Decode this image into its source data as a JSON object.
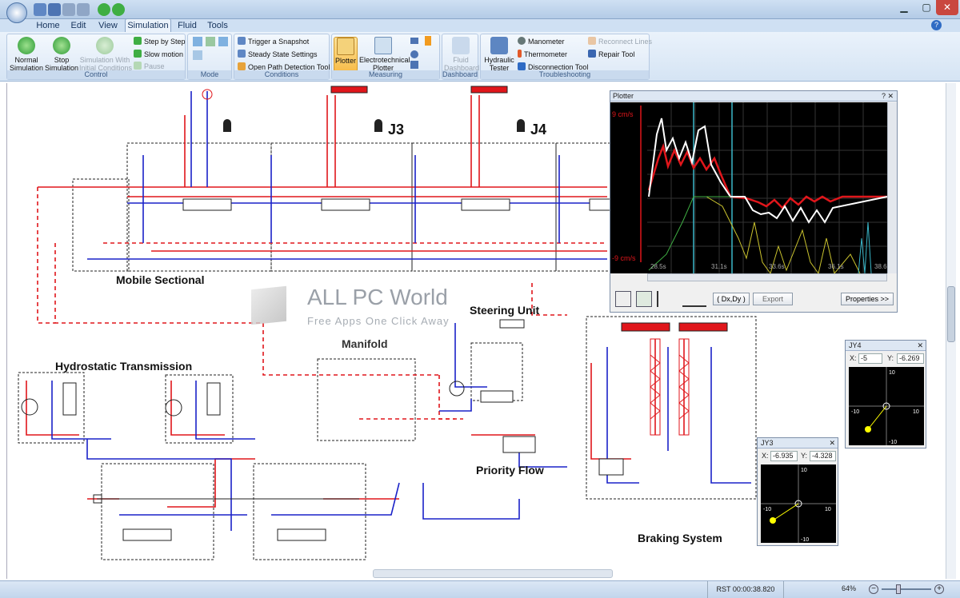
{
  "titlebar": {
    "quick_access_icons": [
      "app-icon",
      "open-icon",
      "save-icon",
      "undo-icon",
      "redo-icon",
      "run-icon",
      "stop-icon"
    ],
    "window_buttons": [
      "minimize",
      "maximize",
      "close"
    ]
  },
  "tabs": [
    {
      "label": "Home",
      "active": false
    },
    {
      "label": "Edit",
      "active": false
    },
    {
      "label": "View",
      "active": false
    },
    {
      "label": "Simulation",
      "active": true
    },
    {
      "label": "Fluid",
      "active": false
    },
    {
      "label": "Tools",
      "active": false
    }
  ],
  "ribbon": {
    "control": {
      "caption": "Control",
      "normal": "Normal\nSimulation",
      "stop": "Stop\nSimulation",
      "initial": "Simulation With\nInitial Conditions",
      "step": "Step by Step",
      "slow": "Slow motion",
      "pause": "Pause"
    },
    "mode": {
      "caption": "Mode"
    },
    "conditions": {
      "caption": "Conditions",
      "trigger": "Trigger a Snapshot",
      "steady": "Steady State Settings",
      "open_path": "Open Path Detection Tool"
    },
    "measuring": {
      "caption": "Measuring",
      "plotter": "Plotter",
      "electro": "Electrotechnical\nPlotter"
    },
    "dashboard": {
      "caption": "Dashboard",
      "fluid": "Fluid\nDashboard"
    },
    "troubleshooting": {
      "caption": "Troubleshooting",
      "tester": "Hydraulic\nTester",
      "manometer": "Manometer",
      "thermometer": "Thermometer",
      "disconnection": "Disconnection Tool",
      "reconnect": "Reconnect Lines",
      "repair": "Repair Tool"
    }
  },
  "diagram": {
    "labels": {
      "mobile_sectional": "Mobile Sectional",
      "hydrostatic": "Hydrostatic Transmission",
      "manifold": "Manifold",
      "steering": "Steering Unit",
      "priority": "Priority Flow",
      "braking": "Braking System",
      "j3": "J3",
      "j4": "J4"
    }
  },
  "watermark": {
    "title": "ALL PC World",
    "subtitle": "Free Apps One Click Away"
  },
  "plotter": {
    "title": "Plotter",
    "y_top_label": "9 cm/s",
    "y_bottom_label": "-9 cm/s",
    "x_ticks": [
      "28.5s",
      "31.1s",
      "33.6s",
      "36.1s",
      "38.6"
    ],
    "buttons": {
      "dxdy": "( Dx,Dy )",
      "export": "Export",
      "properties": "Properties >>"
    }
  },
  "jy4": {
    "title": "JY4",
    "x_label": "X:",
    "x_value": "-5",
    "y_label": "Y:",
    "y_value": "-6.269",
    "ticks": {
      "top": "10",
      "bottom": "-10",
      "left": "-10",
      "right": "10"
    }
  },
  "jy3": {
    "title": "JY3",
    "x_label": "X:",
    "x_value": "-6.935",
    "y_label": "Y:",
    "y_value": "-4.328",
    "ticks": {
      "top": "10",
      "bottom": "-10",
      "left": "-10",
      "right": "10"
    }
  },
  "status": {
    "time": "RST 00:00:38.820",
    "zoom": "64%"
  },
  "colors": {
    "pressure_line": "#e0161b",
    "return_line": "#1a22c8",
    "plot_bg": "#000000",
    "cursor": "#ffff00"
  }
}
